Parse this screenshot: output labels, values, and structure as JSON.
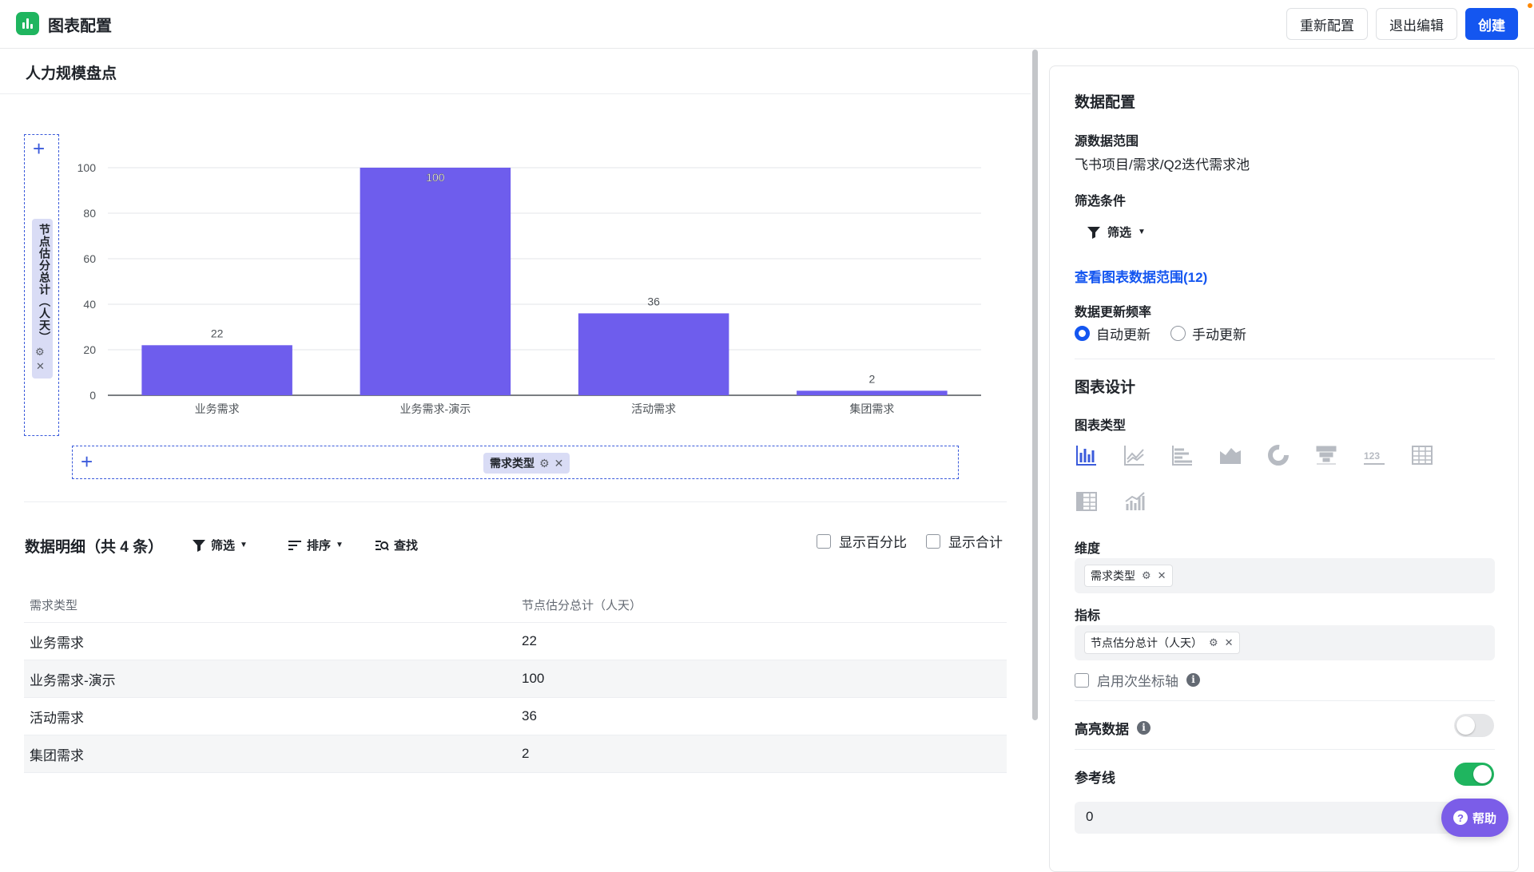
{
  "app": {
    "title": "图表配置"
  },
  "toolbar": {
    "reset": "重新配置",
    "exit": "退出编辑",
    "create": "创建"
  },
  "chart_card": {
    "title": "人力规模盘点",
    "y_field": "节点估分总计（人天）",
    "x_field": "需求类型"
  },
  "chart_data": {
    "type": "bar",
    "categories": [
      "业务需求",
      "业务需求-演示",
      "活动需求",
      "集团需求"
    ],
    "values": [
      22,
      100,
      36,
      2
    ],
    "ylim": [
      0,
      100
    ],
    "yticks": [
      0,
      20,
      40,
      60,
      80,
      100
    ],
    "color": "#6e5ded",
    "grid": true
  },
  "detail": {
    "title": "数据明细（共 4 条）",
    "filter": "筛选",
    "sort": "排序",
    "find": "查找",
    "show_percent": "显示百分比",
    "show_total": "显示合计",
    "columns": [
      "需求类型",
      "节点估分总计（人天）"
    ],
    "rows": [
      [
        "业务需求",
        "22"
      ],
      [
        "业务需求-演示",
        "100"
      ],
      [
        "活动需求",
        "36"
      ],
      [
        "集团需求",
        "2"
      ]
    ]
  },
  "panel": {
    "data_config": "数据配置",
    "source_label": "源数据范围",
    "source_value": "飞书项目/需求/Q2迭代需求池",
    "filter_label": "筛选条件",
    "filter_button": "筛选",
    "view_range": "查看图表数据范围(12)",
    "freq_label": "数据更新频率",
    "freq_auto": "自动更新",
    "freq_manual": "手动更新",
    "design": "图表设计",
    "type_label": "图表类型",
    "dim_label": "维度",
    "dim_chip": "需求类型",
    "metric_label": "指标",
    "metric_chip": "节点估分总计（人天）",
    "secondary_axis": "启用次坐标轴",
    "highlight": "高亮数据",
    "highlight_on": false,
    "refline": "参考线",
    "refline_on": true,
    "refline_value": "0"
  },
  "help": "帮助"
}
